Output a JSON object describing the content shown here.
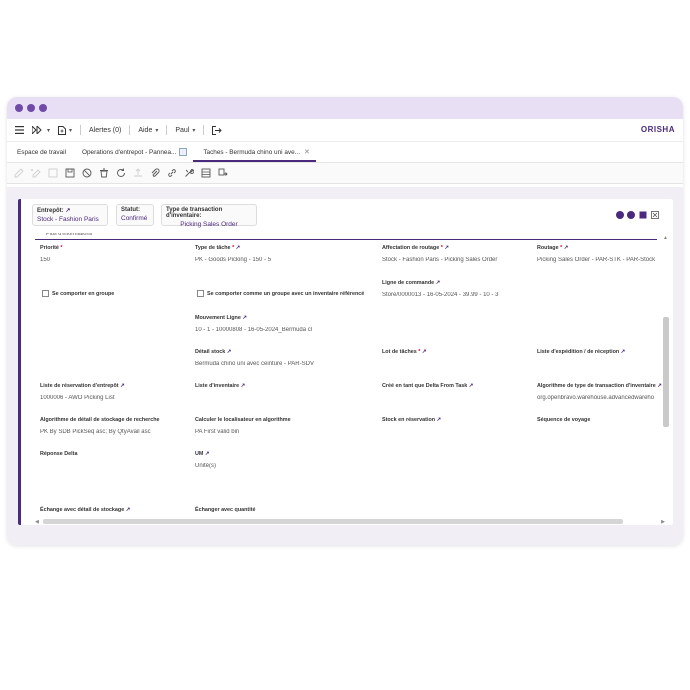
{
  "topbar": {
    "alerts": "Alertes (0)",
    "help": "Aide",
    "user": "Paul",
    "logo_main": "ORISHA"
  },
  "tabs": [
    {
      "label": "Espace de travail"
    },
    {
      "label": "Operations d'entrepot - Pannea..."
    },
    {
      "label": "Taches - Bermuda chino uni ave..."
    }
  ],
  "header_chips": {
    "warehouse": {
      "label": "Entrepôt:",
      "value": "Stock - Fashion Paris"
    },
    "status": {
      "label": "Statut:",
      "value": "Confirmé"
    },
    "inventory_type": {
      "label": "Type de transaction d'inventaire:",
      "value": "Picking Sales Order"
    }
  },
  "section": {
    "title": "Plus d'informations"
  },
  "fields": {
    "priorite": {
      "label": "Priorité",
      "value": "150"
    },
    "type_tache": {
      "label": "Type de tâche",
      "value": "PK - Goods Picking - 150 - 5"
    },
    "affectation_routage": {
      "label": "Affectation de routage",
      "value": "Stock - Fashion Paris - Picking Sales Order"
    },
    "routage": {
      "label": "Routage",
      "value": "Picking Sales Order - PAR-STK - PAR-Stock"
    },
    "se_comporter_groupe": {
      "label": "Se comporter en groupe"
    },
    "se_comporter_inventaire": {
      "label": "Se comporter comme un groupe avec un inventaire référencé"
    },
    "ligne_commande": {
      "label": "Ligne de commande",
      "value": "Store/0000013 - 16-05-2024 - 39.99 - 10 - 3"
    },
    "mouvement_ligne": {
      "label": "Mouvement Ligne",
      "value": "10 - 1 - 10000808 - 16-05-2024_Bermuda cl"
    },
    "detail_stock": {
      "label": "Détail stock",
      "value": "Bermuda chino uni avec ceinture - PAR-SDV"
    },
    "lot_taches": {
      "label": "Lot de tâches"
    },
    "liste_expedition": {
      "label": "Liste d'expédition / de réception"
    },
    "liste_reservation": {
      "label": "Liste de réservation d'entrepôt",
      "value": "1000006 - AWO Picking List"
    },
    "liste_inventaire": {
      "label": "Liste d'inventaire"
    },
    "cree_delta": {
      "label": "Créé en tant que Delta From Task"
    },
    "algo_type_transaction": {
      "label": "Algorithme de type de transaction d'inventaire",
      "value": "org.openbravo.warehouse.advancedwareho"
    },
    "algo_detail_stockage": {
      "label": "Algorithme de détail de stockage de recherche",
      "value": "PK By SDB PickSeq asc; By QtyAvail asc"
    },
    "calculer_localisateur": {
      "label": "Calculer le localisateur en algorithme",
      "value": "PA First valid bin"
    },
    "stock_reservation": {
      "label": "Stock en réservation"
    },
    "sequence_voyage": {
      "label": "Séquence de voyage"
    },
    "reponse_delta": {
      "label": "Réponse Delta"
    },
    "um": {
      "label": "UM",
      "value": "Unité(s)"
    },
    "echange_detail": {
      "label": "Échange avec détail de stockage"
    },
    "echanger_quantite": {
      "label": "Échanger avec quantité"
    }
  },
  "colors": {
    "accent": "#4b2a7e",
    "titlebar": "#e9dff5",
    "dot": "#6f4aa7",
    "logo_accent": "#d64b2f"
  }
}
